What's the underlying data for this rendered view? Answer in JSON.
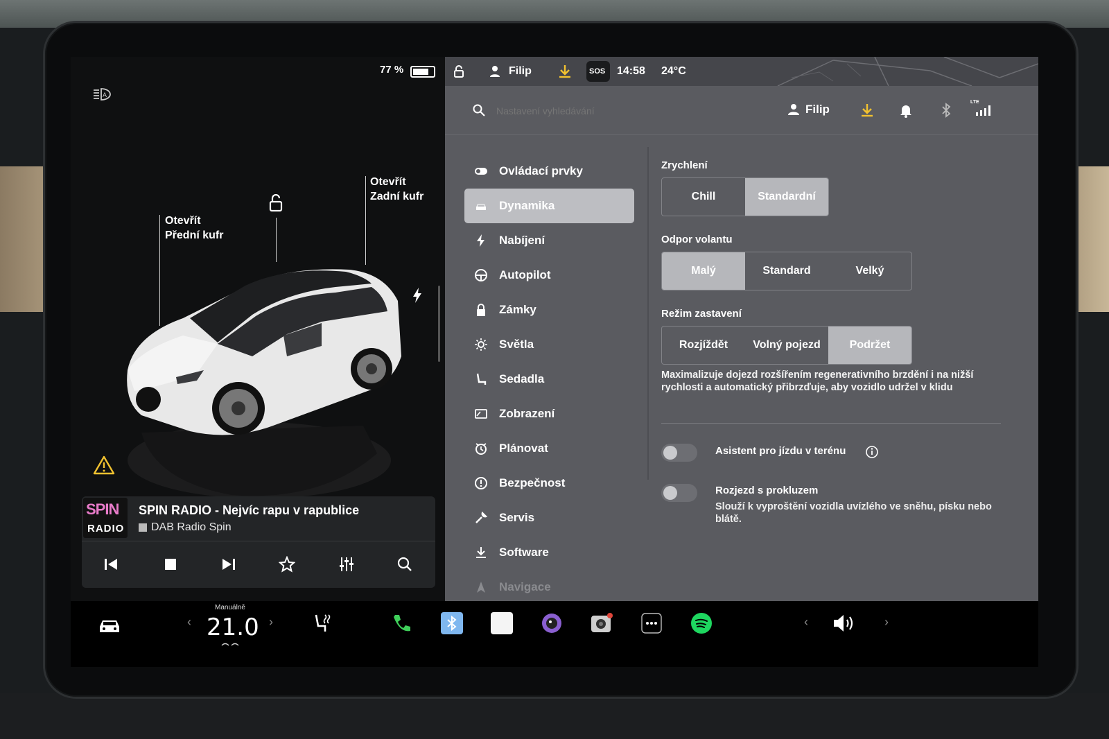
{
  "status": {
    "battery_percent": "77 %",
    "user": "Filip",
    "time": "14:58",
    "temperature": "24°C",
    "sos": "SOS"
  },
  "vehicle": {
    "frunk_label_1": "Otevřít",
    "frunk_label_2": "Přední kufr",
    "trunk_label_1": "Otevřít",
    "trunk_label_2": "Zadní kufr"
  },
  "media": {
    "logo_top": "SPIN",
    "logo_bottom": "RADIO",
    "title": "SPIN RADIO - Nejvíc rapu v rapublice",
    "source": "DAB Radio Spin"
  },
  "search": {
    "placeholder": "Nastavení vyhledávání"
  },
  "header": {
    "user": "Filip",
    "signal": "LTE"
  },
  "nav": {
    "items": [
      {
        "label": "Ovládací prvky",
        "icon": "toggle-icon"
      },
      {
        "label": "Dynamika",
        "icon": "car-icon"
      },
      {
        "label": "Nabíjení",
        "icon": "bolt-icon"
      },
      {
        "label": "Autopilot",
        "icon": "steering-wheel-icon"
      },
      {
        "label": "Zámky",
        "icon": "lock-icon"
      },
      {
        "label": "Světla",
        "icon": "sun-icon"
      },
      {
        "label": "Sedadla",
        "icon": "seat-icon"
      },
      {
        "label": "Zobrazení",
        "icon": "display-icon"
      },
      {
        "label": "Plánovat",
        "icon": "clock-icon"
      },
      {
        "label": "Bezpečnost",
        "icon": "alert-circle-icon"
      },
      {
        "label": "Servis",
        "icon": "wrench-icon"
      },
      {
        "label": "Software",
        "icon": "download-icon"
      },
      {
        "label": "Navigace",
        "icon": "navigation-icon"
      }
    ],
    "active": "Dynamika"
  },
  "settings": {
    "acceleration": {
      "title": "Zrychlení",
      "options": [
        "Chill",
        "Standardní"
      ],
      "selected": "Standardní"
    },
    "steering": {
      "title": "Odpor volantu",
      "options": [
        "Malý",
        "Standard",
        "Velký"
      ],
      "selected": "Malý"
    },
    "stopping": {
      "title": "Režim zastavení",
      "options": [
        "Rozjíždět",
        "Volný pojezd",
        "Podržet"
      ],
      "selected": "Podržet",
      "description": "Maximalizuje dojezd rozšířením regenerativního brzdění i na nižší rychlosti a automatický přibrzďuje, aby vozidlo udržel v klidu"
    },
    "offroad": {
      "title": "Asistent pro jízdu v terénu",
      "enabled": false
    },
    "slip_start": {
      "title": "Rozjezd s prokluzem",
      "subtitle": "Slouží k vyproštění vozidla uvízlého ve sněhu, písku nebo blátě.",
      "enabled": false
    }
  },
  "dock": {
    "climate_mode": "Manuálně",
    "temperature": "21.0",
    "icons": [
      "car-icon",
      "seat-heat-icon",
      "phone-icon",
      "bluetooth-icon",
      "notes-icon",
      "camera-lens-icon",
      "dashcam-icon",
      "more-icon",
      "spotify-icon",
      "volume-icon"
    ]
  },
  "colors": {
    "panel": "#5a5b60",
    "selected": "#b6b7bb",
    "accent_yellow": "#f2c230",
    "spotify": "#1ed760",
    "phone": "#3fcf5a"
  }
}
